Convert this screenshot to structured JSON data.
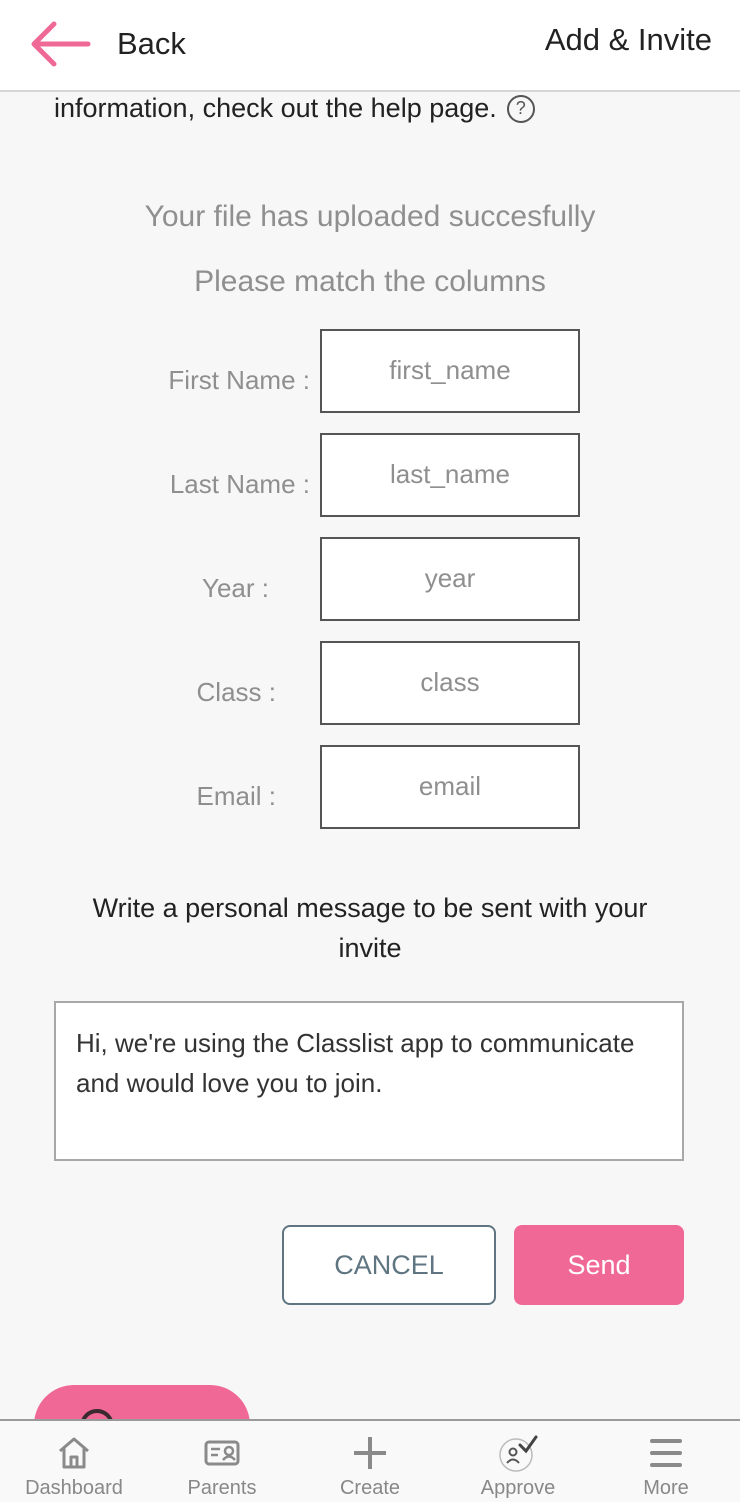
{
  "header": {
    "back_label": "Back",
    "title": "Add & Invite"
  },
  "intro": {
    "help_text": "information, check out the help page.",
    "help_icon": "?"
  },
  "upload": {
    "success_text": "Your file has uploaded succesfully",
    "match_text": "Please match the columns"
  },
  "columns": [
    {
      "label": "First Name :",
      "value": "first_name"
    },
    {
      "label": "Last Name :",
      "value": "last_name"
    },
    {
      "label": "Year :",
      "value": "year"
    },
    {
      "label": "Class :",
      "value": "class"
    },
    {
      "label": "Email :",
      "value": "email"
    }
  ],
  "message": {
    "heading": "Write a personal message to be sent with your invite",
    "body": "Hi, we're using the Classlist app to communicate and would love you to join."
  },
  "actions": {
    "cancel_label": "CANCEL",
    "send_label": "Send"
  },
  "nav": [
    {
      "label": "Dashboard",
      "icon": "home-icon"
    },
    {
      "label": "Parents",
      "icon": "id-card-icon"
    },
    {
      "label": "Create",
      "icon": "plus-icon"
    },
    {
      "label": "Approve",
      "icon": "approve-icon"
    },
    {
      "label": "More",
      "icon": "menu-icon"
    }
  ],
  "colors": {
    "accent": "#ef6896",
    "muted_text": "#8f8f8f",
    "cancel_border": "#5f7581"
  }
}
